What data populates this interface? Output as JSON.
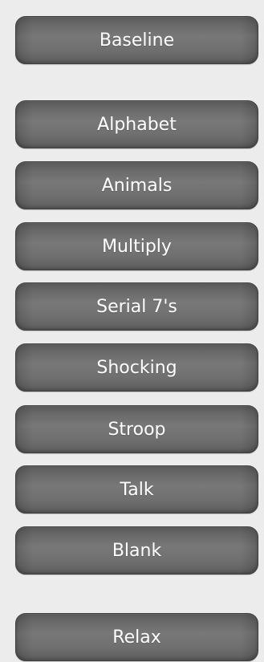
{
  "buttons": {
    "baseline": "Baseline",
    "alphabet": "Alphabet",
    "animals": "Animals",
    "multiply": "Multiply",
    "serial_7s": "Serial 7's",
    "shocking": "Shocking",
    "stroop": "Stroop",
    "talk": "Talk",
    "blank": "Blank",
    "relax": "Relax"
  },
  "colors": {
    "panel_background": "#ececec",
    "button_fill": "#6f6f6f",
    "button_text": "#ffffff"
  }
}
